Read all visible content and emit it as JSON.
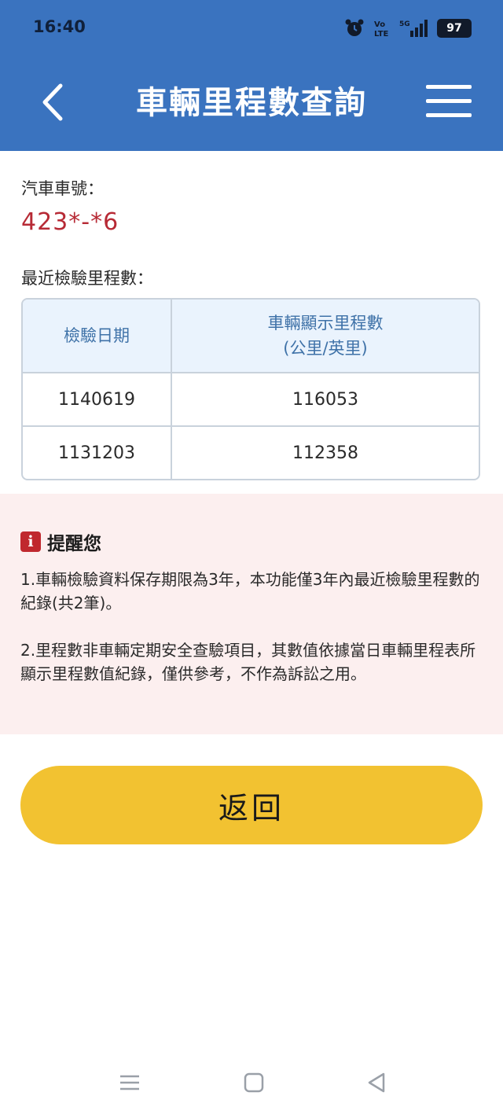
{
  "status_bar": {
    "time": "16:40",
    "battery": "97",
    "icons": [
      "alarm-icon",
      "volte-icon",
      "signal-icon",
      "battery-icon"
    ]
  },
  "header": {
    "title": "車輛里程數查詢",
    "back_icon": "chevron-left-icon",
    "menu_icon": "hamburger-menu-icon"
  },
  "vehicle": {
    "plate_label": "汽車車號：",
    "plate_value": "423*-*6"
  },
  "mileage": {
    "section_label": "最近檢驗里程數：",
    "columns": [
      "檢驗日期",
      "車輛顯示里程數",
      "(公里/英里)"
    ],
    "rows": [
      {
        "date": "1140619",
        "mileage": "116053"
      },
      {
        "date": "1131203",
        "mileage": "112358"
      }
    ]
  },
  "reminder": {
    "icon": "info-icon",
    "icon_glyph": "i",
    "title": "提醒您",
    "items": [
      "1.車輛檢驗資料保存期限為3年，本功能僅3年內最近檢驗里程數的紀錄(共2筆)。",
      "2.里程數非車輛定期安全查驗項目，其數值依據當日車輛里程表所顯示里程數值紀錄，僅供參考，不作為訴訟之用。"
    ]
  },
  "actions": {
    "return_label": "返回"
  },
  "colors": {
    "header_bg": "#3a73bf",
    "plate_red": "#b72a35",
    "table_head_bg": "#eaf3fd",
    "reminder_bg": "#fcefef",
    "button_yellow": "#f2c231"
  }
}
